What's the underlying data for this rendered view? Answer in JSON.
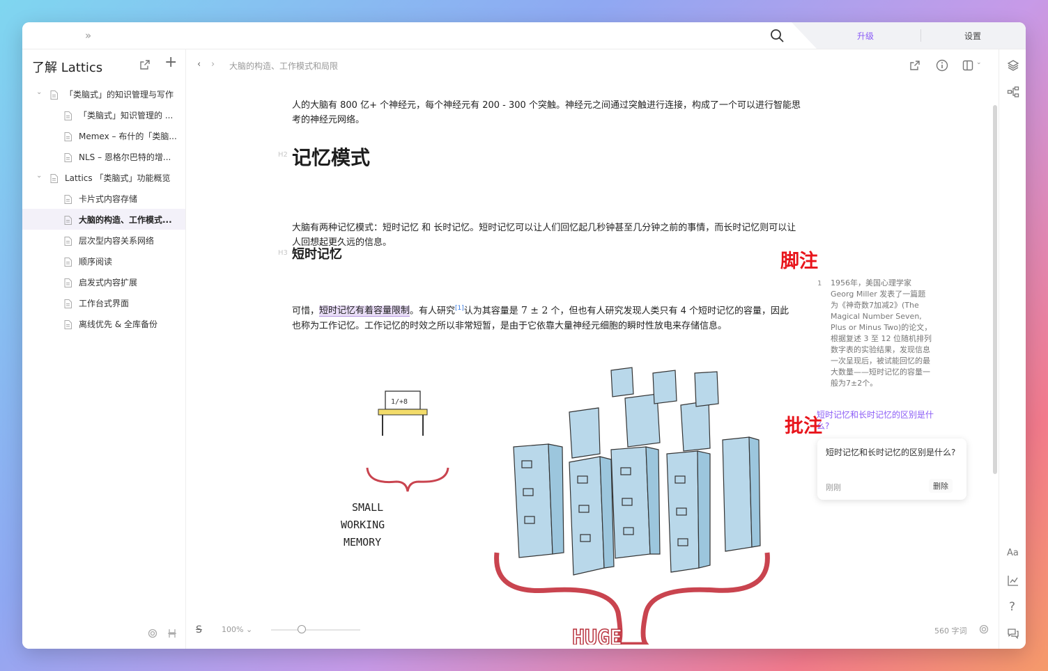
{
  "titlebar": {
    "expand_icon": "»",
    "upgrade_label": "升级",
    "settings_label": "设置",
    "accent_color": "#8b5cf6"
  },
  "sidebar": {
    "title": "了解 Lattics",
    "items": [
      {
        "label": "「类脑式」的知识管理与写作",
        "level": 0,
        "expanded": true
      },
      {
        "label": "「类脑式」知识管理的 ...",
        "level": 1
      },
      {
        "label": "Memex – 布什的「类脑...",
        "level": 1
      },
      {
        "label": "NLS – 恩格尔巴特的增...",
        "level": 1
      },
      {
        "label": "Lattics 「类脑式」功能概览",
        "level": 0,
        "expanded": true
      },
      {
        "label": "卡片式内容存储",
        "level": 1
      },
      {
        "label": "大脑的构造、工作模式...",
        "level": 1,
        "active": true
      },
      {
        "label": "层次型内容关系网络",
        "level": 1
      },
      {
        "label": "顺序阅读",
        "level": 1
      },
      {
        "label": "启发式内容扩展",
        "level": 1
      },
      {
        "label": "工作台式界面",
        "level": 1
      },
      {
        "label": "离线优先 & 全库备份",
        "level": 1
      }
    ]
  },
  "main": {
    "breadcrumb": "大脑的构造、工作模式和局限",
    "intro": "人的大脑有 800 亿+ 个神经元，每个神经元有 200 - 300 个突触。神经元之间通过突触进行连接，构成了一个可以进行智能思考的神经元网络。",
    "h2_tag": "H2",
    "h2": "记忆模式",
    "memory_para": "大脑有两种记忆模式：短时记忆 和 长时记忆。短时记忆可以让人们回忆起几秒钟甚至几分钟之前的事情，而长时记忆则可以让人回想起更久远的信息。",
    "h3_tag": "H3",
    "h3": "短时记忆",
    "stm": {
      "prefix": "可惜，",
      "highlight": "短时记忆有着容量限制",
      "middle": "。有人研究",
      "fn_ref": "[1]",
      "after_ref": "认为其容量是 ",
      "math": "7 ± 2",
      "rest": " 个，但也有人研究发现人类只有 4 个短时记忆的容量，因此也称为工作记忆。工作记忆的时效之所以非常短暂，是由于它依靠大量神经元细胞的瞬时性放电来存储信息。"
    },
    "illustration": {
      "small_lines": [
        "SMALL",
        "WORKING",
        "MEMORY"
      ],
      "huge_label": "HUGE",
      "board_text": "1/+8"
    }
  },
  "annotations": {
    "footnote_label": "脚注",
    "comment_label": "批注",
    "footnote_num": "1",
    "footnote_text": "1956年，美国心理学家Georg Miller 发表了一篇题为《神奇数7加减2》(The Magical Number Seven, Plus or Minus Two)的论文，根据复述 3 至 12 位随机排列数字表的实验结果，发现信息一次呈现后，被试能回忆的最大数量——短时记忆的容量一般为7±2个。",
    "comment_quote": "短时记忆和长时记忆的区别是什么?",
    "comment_body": "短时记忆和长时记忆的区别是什么?",
    "comment_time": "刚刚",
    "comment_delete": "删除"
  },
  "footer": {
    "zoom": "100% ⌄",
    "word_count": "560 字词"
  },
  "rightbar": {
    "font_label": "Aa",
    "help_label": "?"
  }
}
